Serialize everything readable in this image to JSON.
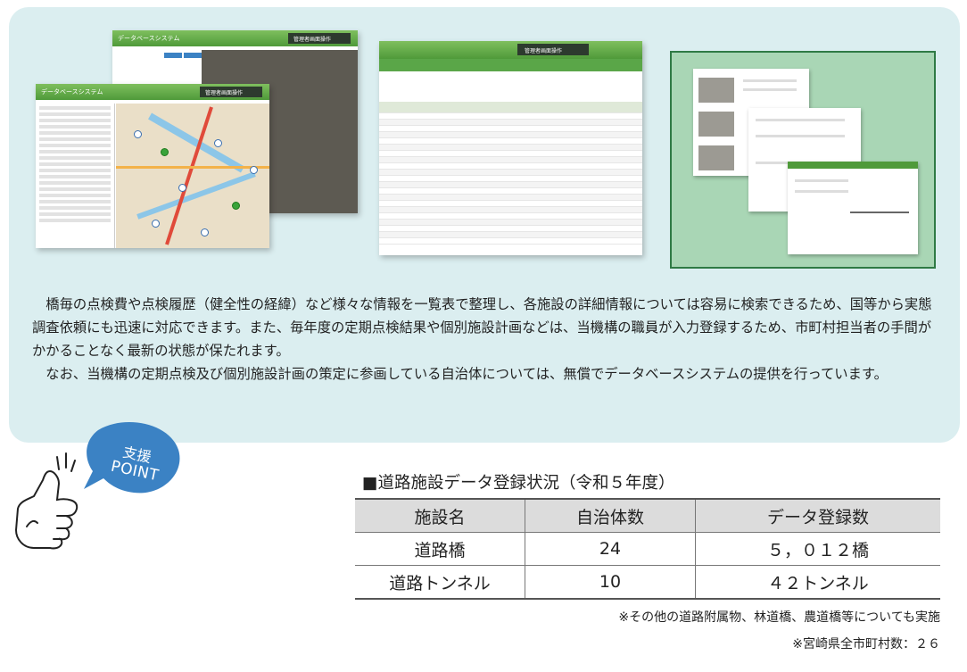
{
  "screenshots": {
    "map_window_back": {
      "title": "データベースシステム",
      "button": "管理者画面操作"
    },
    "map_window_front": {
      "title": "データベースシステム",
      "button": "管理者画面操作"
    },
    "list_window": {
      "button": "管理者画面操作"
    }
  },
  "description": {
    "paragraphs": [
      "　橋毎の点検費や点検履歴（健全性の経緯）など様々な情報を一覧表で整理し、各施設の詳細情報については容易に検索できるため、国等から実態調査依頼にも迅速に対応できます。また、毎年度の定期点検結果や個別施設計画などは、当機構の職員が入力登録するため、市町村担当者の手間がかかることなく最新の状態が保たれます。",
      "　なお、当機構の定期点検及び個別施設計画の策定に参画している自治体については、無償でデータベースシステムの提供を行っています。"
    ]
  },
  "badge": {
    "line1": "支援",
    "line2": "POINT"
  },
  "table": {
    "title": "■道路施設データ登録状況（令和５年度）",
    "headers": [
      "施設名",
      "自治体数",
      "データ登録数"
    ],
    "rows": [
      [
        "道路橋",
        "24",
        "５，０１２橋"
      ],
      [
        "道路トンネル",
        "10",
        "４２トンネル"
      ]
    ]
  },
  "notes": {
    "note1": "※その他の道路附属物、林道橋、農道橋等についても実施",
    "note2": "※宮崎県全市町村数：２６"
  },
  "colors": {
    "panel": "#dbeef0",
    "accent_green": "#4f9a3a",
    "badge_blue": "#3b82c4"
  }
}
